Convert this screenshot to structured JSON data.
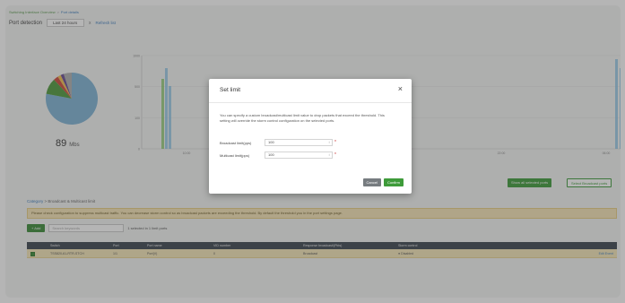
{
  "breadcrumb": {
    "parent": "Switching Interface Overview",
    "current": "Port details"
  },
  "header": {
    "title": "Port detection",
    "time_range": "Last 24 hours",
    "x_mark": "x",
    "refresh_link": "Refresh list"
  },
  "stats": {
    "value": "89",
    "unit": "Mbs"
  },
  "chart_data": {
    "type": "bar",
    "yticks": [
      "1000",
      "500",
      "100",
      "0"
    ],
    "xticks": [
      "10:00",
      "14:00",
      "18:00",
      "22:00",
      "06:00"
    ],
    "series": [
      {
        "color": "#8dc96e",
        "values": [
          0,
          78,
          0,
          0,
          0,
          0,
          0,
          0,
          0,
          0
        ]
      },
      {
        "color": "#8ec6e6",
        "values": [
          0,
          90,
          60,
          0,
          0,
          0,
          0,
          0,
          0,
          95
        ]
      }
    ],
    "pie": [
      {
        "color": "#7fb3d5",
        "value": 78
      },
      {
        "color": "#4f9a3c",
        "value": 10
      },
      {
        "color": "#d04a3a",
        "value": 3
      },
      {
        "color": "#f2c14e",
        "value": 2
      },
      {
        "color": "#6a4c93",
        "value": 2
      },
      {
        "color": "#b0b0b0",
        "value": 5
      }
    ]
  },
  "buttons": {
    "green": "Show all selected ports",
    "outline": "Select Broadcast ports"
  },
  "section": {
    "breadcrumb_link": "Category",
    "breadcrumb_text": "> Broadcast & Multicast limit"
  },
  "notice": "Please check configuration to suppress multicast traffic. You can decrease storm control so as broadcast packets are exceeding the threshold. By default the threshold you in the port settings page.",
  "toolbar": {
    "add": "+ Add",
    "search_placeholder": "Search keywords",
    "selected_info": "1 selected in 1 limit ports"
  },
  "table": {
    "headers": [
      "",
      "Switch",
      "Port",
      "Port name",
      "VID number",
      "Response broadcast/(Pkts)",
      "Storm control",
      ""
    ],
    "rows": [
      {
        "check": "",
        "switch": "TSS820-61-RTR-STCH",
        "port": "1/1",
        "name": "Port(V)",
        "vid": "0",
        "response": "Broadcast",
        "storm": "● Disabled",
        "action": "Edit Event"
      }
    ]
  },
  "modal": {
    "title": "Set limit",
    "close": "×",
    "description": "You can specify a custom broadcast/multicast limit value to drop packets that exceed the threshold. This setting will override the storm control configuration on the selected ports.",
    "broadcast_label": "Broadcast limit(pps)",
    "broadcast_value": "100",
    "multicast_label": "Multicast limit(pps)",
    "multicast_value": "100",
    "cancel": "Cancel",
    "confirm": "Confirm"
  }
}
